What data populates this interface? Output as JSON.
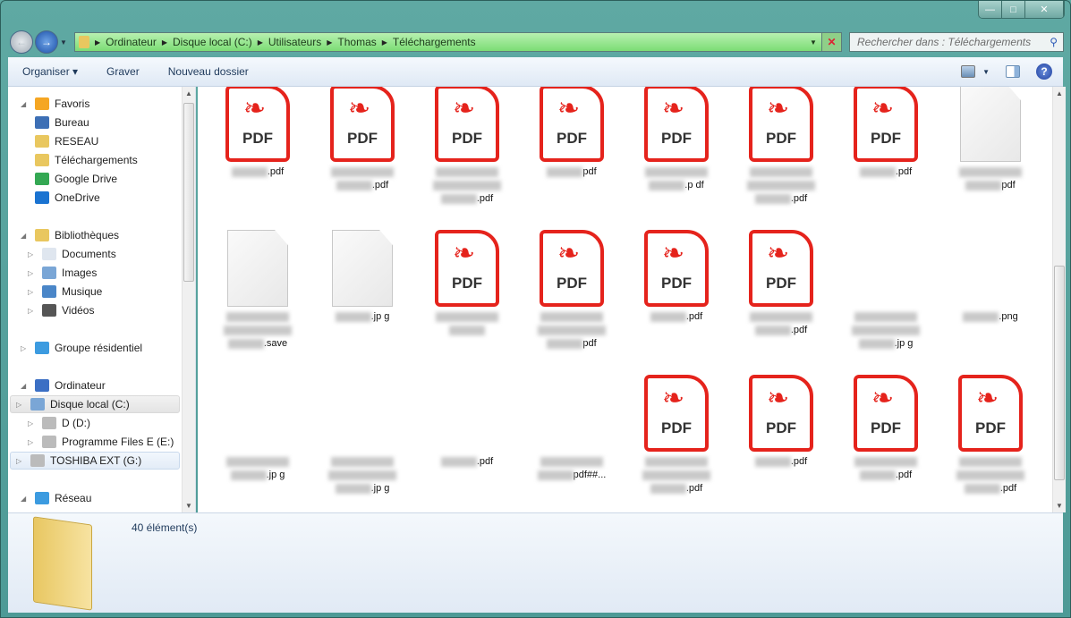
{
  "window": {
    "minimize": "—",
    "maximize": "□",
    "close": "✕"
  },
  "address": {
    "crumbs": [
      "Ordinateur",
      "Disque local (C:)",
      "Utilisateurs",
      "Thomas",
      "Téléchargements"
    ]
  },
  "search": {
    "placeholder": "Rechercher dans : Téléchargements"
  },
  "toolbar": {
    "organise": "Organiser ▾",
    "burn": "Graver",
    "new_folder": "Nouveau dossier"
  },
  "sidebar": {
    "favorites": {
      "label": "Favoris",
      "items": [
        "Bureau",
        "RESEAU",
        "Téléchargements",
        "Google Drive",
        "OneDrive"
      ]
    },
    "libraries": {
      "label": "Bibliothèques",
      "items": [
        "Documents",
        "Images",
        "Musique",
        "Vidéos"
      ]
    },
    "homegroup": "Groupe résidentiel",
    "computer": {
      "label": "Ordinateur",
      "items": [
        "Disque local (C:)",
        "D (D:)",
        "Programme Files E (E:)",
        "TOSHIBA EXT (G:)"
      ]
    },
    "network": "Réseau"
  },
  "files": [
    {
      "icon": "pdf",
      "text": ".pdf"
    },
    {
      "icon": "pdf",
      "text": ".pdf"
    },
    {
      "icon": "pdf",
      "text": ".pdf"
    },
    {
      "icon": "pdf",
      "text": "pdf"
    },
    {
      "icon": "pdf",
      "text": ".p df"
    },
    {
      "icon": "pdf",
      "text": ".pdf"
    },
    {
      "icon": "pdf",
      "text": ".pdf"
    },
    {
      "icon": "blank",
      "text": "pdf"
    },
    {
      "icon": "blank",
      "text": ".save"
    },
    {
      "icon": "blank",
      "text": ".jp g"
    },
    {
      "icon": "pdf",
      "text": ""
    },
    {
      "icon": "pdf",
      "text": "pdf"
    },
    {
      "icon": "pdf",
      "text": ".pdf"
    },
    {
      "icon": "pdf",
      "text": ".pdf"
    },
    {
      "icon": "none",
      "text": ".jp g"
    },
    {
      "icon": "none",
      "text": ".png"
    },
    {
      "icon": "none",
      "text": ".jp g"
    },
    {
      "icon": "none",
      "text": ".jp g"
    },
    {
      "icon": "none",
      "text": ".pdf"
    },
    {
      "icon": "none",
      "text": "pdf##..."
    },
    {
      "icon": "pdf",
      "text": ".pdf"
    },
    {
      "icon": "pdf",
      "text": ".pdf"
    },
    {
      "icon": "pdf",
      "text": ".pdf"
    },
    {
      "icon": "pdf",
      "text": ".pdf"
    }
  ],
  "pdf_label": "PDF",
  "status": {
    "count": "40 élément(s)"
  },
  "colors": {
    "pdf_red": "#e5231c",
    "address_green": "#7bdd74"
  }
}
